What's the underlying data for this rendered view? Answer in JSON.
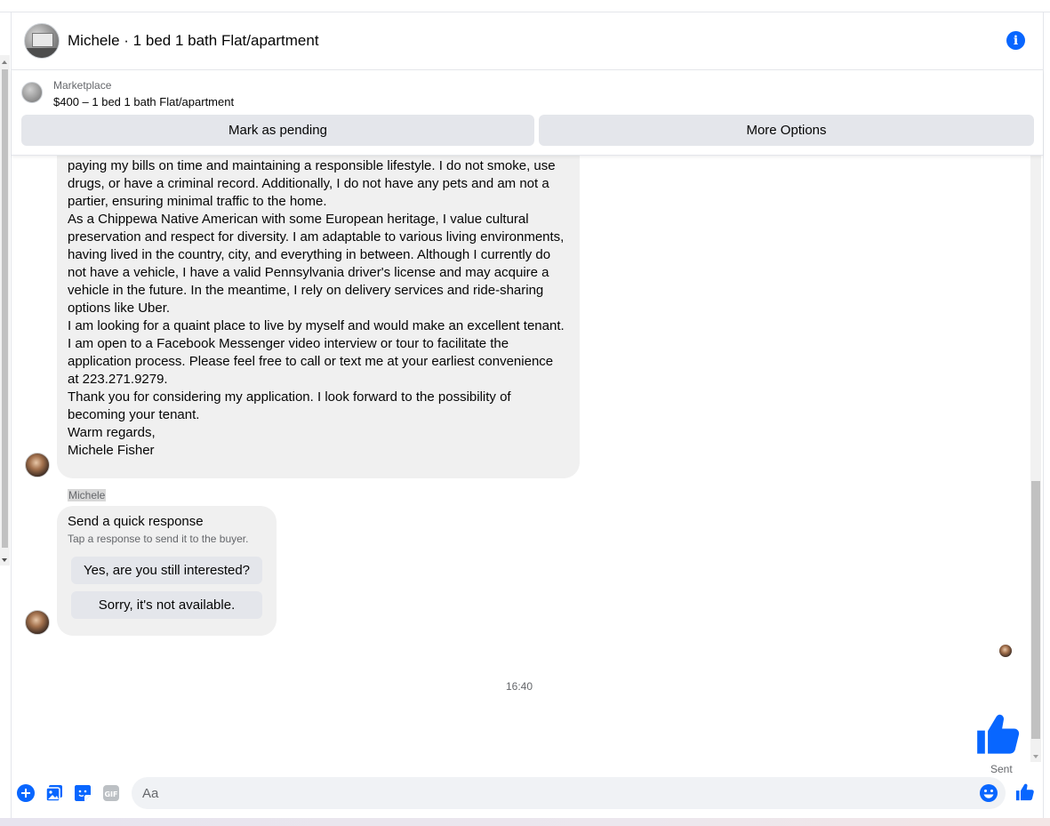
{
  "header": {
    "title": "Michele · 1 bed 1 bath Flat/apartment",
    "info_icon": "info-icon"
  },
  "listing": {
    "label": "Marketplace",
    "price_title": "$400 – 1 bed 1 bath Flat/apartment",
    "mark_pending": "Mark as pending",
    "more_options": "More Options"
  },
  "message": {
    "paragraphs": [
      "paying my bills on time and maintaining a responsible lifestyle. I do not smoke, use drugs, or have a criminal record. Additionally, I do not have any pets and am not a partier, ensuring minimal traffic to the home.",
      "As a Chippewa Native American with some European heritage, I value cultural preservation and respect for diversity. I am adaptable to various living environments, having lived in the country, city, and everything in between. Although I currently do not have a vehicle, I have a valid Pennsylvania driver's license and may acquire a vehicle in the future. In the meantime, I rely on delivery services and ride-sharing options like Uber.",
      "I am looking for a quaint place to live by myself and would make an excellent tenant. I am open to a Facebook Messenger video interview or tour to facilitate the application process. Please feel free to call or text me at your earliest convenience at 223.271.9279.",
      "Thank you for considering my application. I look forward to the possibility of becoming your tenant.",
      "Warm regards,",
      "Michele Fisher"
    ]
  },
  "sender_name": "Michele",
  "quick_response": {
    "title": "Send a quick response",
    "subtitle": "Tap a response to send it to the buyer.",
    "option_1": "Yes, are you still interested?",
    "option_2": "Sorry, it's not available."
  },
  "timestamp": "16:40",
  "sent_label": "Sent",
  "composer": {
    "placeholder": "Aa",
    "value": ""
  },
  "colors": {
    "accent": "#0866ff",
    "bubble": "#f0f0f0",
    "button": "#e4e6eb"
  }
}
